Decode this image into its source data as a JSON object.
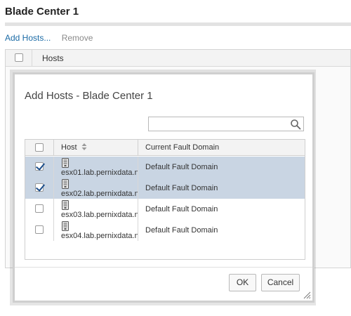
{
  "page": {
    "title": "Blade Center 1",
    "toolbar": {
      "add_label": "Add Hosts...",
      "remove_label": "Remove"
    },
    "grid": {
      "column_header": "Hosts"
    }
  },
  "dialog": {
    "title": "Add Hosts - Blade Center 1",
    "search": {
      "placeholder": "",
      "value": ""
    },
    "columns": {
      "host": "Host",
      "fault_domain": "Current Fault Domain"
    },
    "rows": [
      {
        "checked": true,
        "host": "esx01.lab.pernixdata.n",
        "fault_domain": "Default Fault Domain"
      },
      {
        "checked": true,
        "host": "esx02.lab.pernixdata.n",
        "fault_domain": "Default Fault Domain"
      },
      {
        "checked": false,
        "host": "esx03.lab.pernixdata.n",
        "fault_domain": "Default Fault Domain"
      },
      {
        "checked": false,
        "host": "esx04.lab.pernixdata.n",
        "fault_domain": "Default Fault Domain"
      }
    ],
    "buttons": {
      "ok": "OK",
      "cancel": "Cancel"
    }
  },
  "colors": {
    "selected_row": "#c9d5e3",
    "link": "#1b6ba6",
    "checkmark": "#1d4f8c"
  },
  "icons": {
    "host": "server-icon",
    "search": "search-icon",
    "sort": "sort-icon",
    "resize": "resize-grip-icon"
  }
}
